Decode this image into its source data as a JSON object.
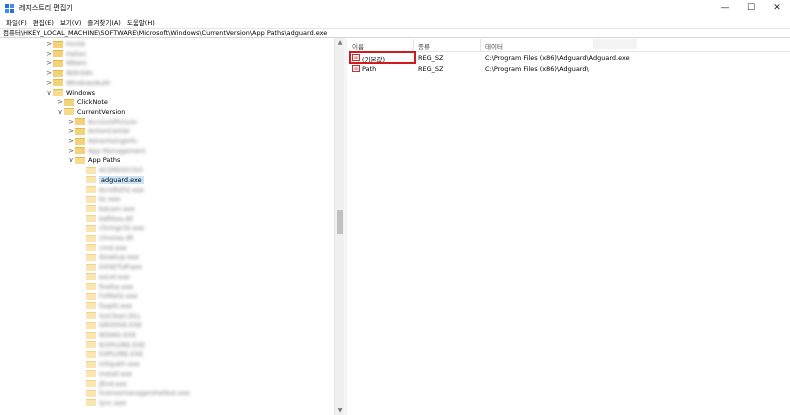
{
  "window": {
    "title": "레지스트리 편집기",
    "controls": {
      "minimize": "—",
      "maximize": "☐",
      "close": "✕"
    }
  },
  "menu": [
    "파일(F)",
    "편집(E)",
    "보기(V)",
    "즐겨찾기(A)",
    "도움말(H)"
  ],
  "address": "컴퓨터\\HKEY_LOCAL_MACHINE\\SOFTWARE\\Microsoft\\Windows\\CurrentVersion\\App Paths\\adguard.exe",
  "tree": [
    {
      "label": "Hvmb",
      "expander": ">",
      "blurred": true
    },
    {
      "label": "Halian",
      "expander": ">",
      "blurred": true
    },
    {
      "label": "Wbem",
      "expander": ">",
      "blurred": true
    },
    {
      "label": "WdnSdn",
      "expander": ">",
      "blurred": true
    },
    {
      "label": "WindowsAuth",
      "expander": ">",
      "blurred": true
    },
    {
      "label": "Windows",
      "expander": "∨",
      "blurred": false
    },
    {
      "label": "ClickNote",
      "expander": ">",
      "blurred": false
    },
    {
      "label": "CurrentVersion",
      "expander": "∨",
      "blurred": false
    },
    {
      "label": "AccountPicture",
      "expander": ">",
      "blurred": true
    },
    {
      "label": "ActionCenter",
      "expander": ">",
      "blurred": true
    },
    {
      "label": "AdvertisingInfo",
      "expander": ">",
      "blurred": true
    },
    {
      "label": "App Management",
      "expander": ">",
      "blurred": true
    },
    {
      "label": "App Paths",
      "expander": "∨",
      "blurred": false
    },
    {
      "label": "ACDREDCOUI",
      "expander": "",
      "blurred": true
    },
    {
      "label": "adguard.exe",
      "expander": "",
      "blurred": false,
      "selected": true
    },
    {
      "label": "AcroRd32.exe",
      "expander": "",
      "blurred": true
    },
    {
      "label": "bc.exe",
      "expander": "",
      "blurred": true
    },
    {
      "label": "bdcam.exe",
      "expander": "",
      "blurred": true
    },
    {
      "label": "bdfiltes.dll",
      "expander": "",
      "blurred": true
    },
    {
      "label": "chrmgr32.exe",
      "expander": "",
      "blurred": true
    },
    {
      "label": "chrome.dll",
      "expander": "",
      "blurred": true
    },
    {
      "label": "cmd.exe",
      "expander": "",
      "blurred": true
    },
    {
      "label": "dxsetup.exe",
      "expander": "",
      "blurred": true
    },
    {
      "label": "DXSETUP.exe",
      "expander": "",
      "blurred": true
    },
    {
      "label": "excel.exe",
      "expander": "",
      "blurred": true
    },
    {
      "label": "firefox.exe",
      "expander": "",
      "blurred": true
    },
    {
      "label": "FxMail2.exe",
      "expander": "",
      "blurred": true
    },
    {
      "label": "fzsplit.exe",
      "expander": "",
      "blurred": true
    },
    {
      "label": "GoClean.DLL",
      "expander": "",
      "blurred": true
    },
    {
      "label": "GROOVE.EXE",
      "expander": "",
      "blurred": true
    },
    {
      "label": "IEDIAG.EXE",
      "expander": "",
      "blurred": true
    },
    {
      "label": "IEXPLORE.EXE",
      "expander": "",
      "blurred": true
    },
    {
      "label": "EXPLORE.EXE",
      "expander": "",
      "blurred": true
    },
    {
      "label": "infopath.exe",
      "expander": "",
      "blurred": true
    },
    {
      "label": "install.exe",
      "expander": "",
      "blurred": true
    },
    {
      "label": "jfind.exe",
      "expander": "",
      "blurred": true
    },
    {
      "label": "licensemanagershellext.exe",
      "expander": "",
      "blurred": true
    },
    {
      "label": "lync.exe",
      "expander": "",
      "blurred": true
    }
  ],
  "list": {
    "headers": {
      "name": "이름",
      "type": "종류",
      "data": "데이터"
    },
    "rows": [
      {
        "icon": "ab",
        "name": "(기본값)",
        "type": "REG_SZ",
        "data": "C:\\Program Files (x86)\\Adguard\\Adguard.exe"
      },
      {
        "icon": "ab",
        "name": "Path",
        "type": "REG_SZ",
        "data": "C:\\Program Files (x86)\\Adguard\\"
      }
    ]
  },
  "colors": {
    "highlight": "#d31a1a",
    "selection": "#cce4f7",
    "folder": "#f4d27a"
  }
}
